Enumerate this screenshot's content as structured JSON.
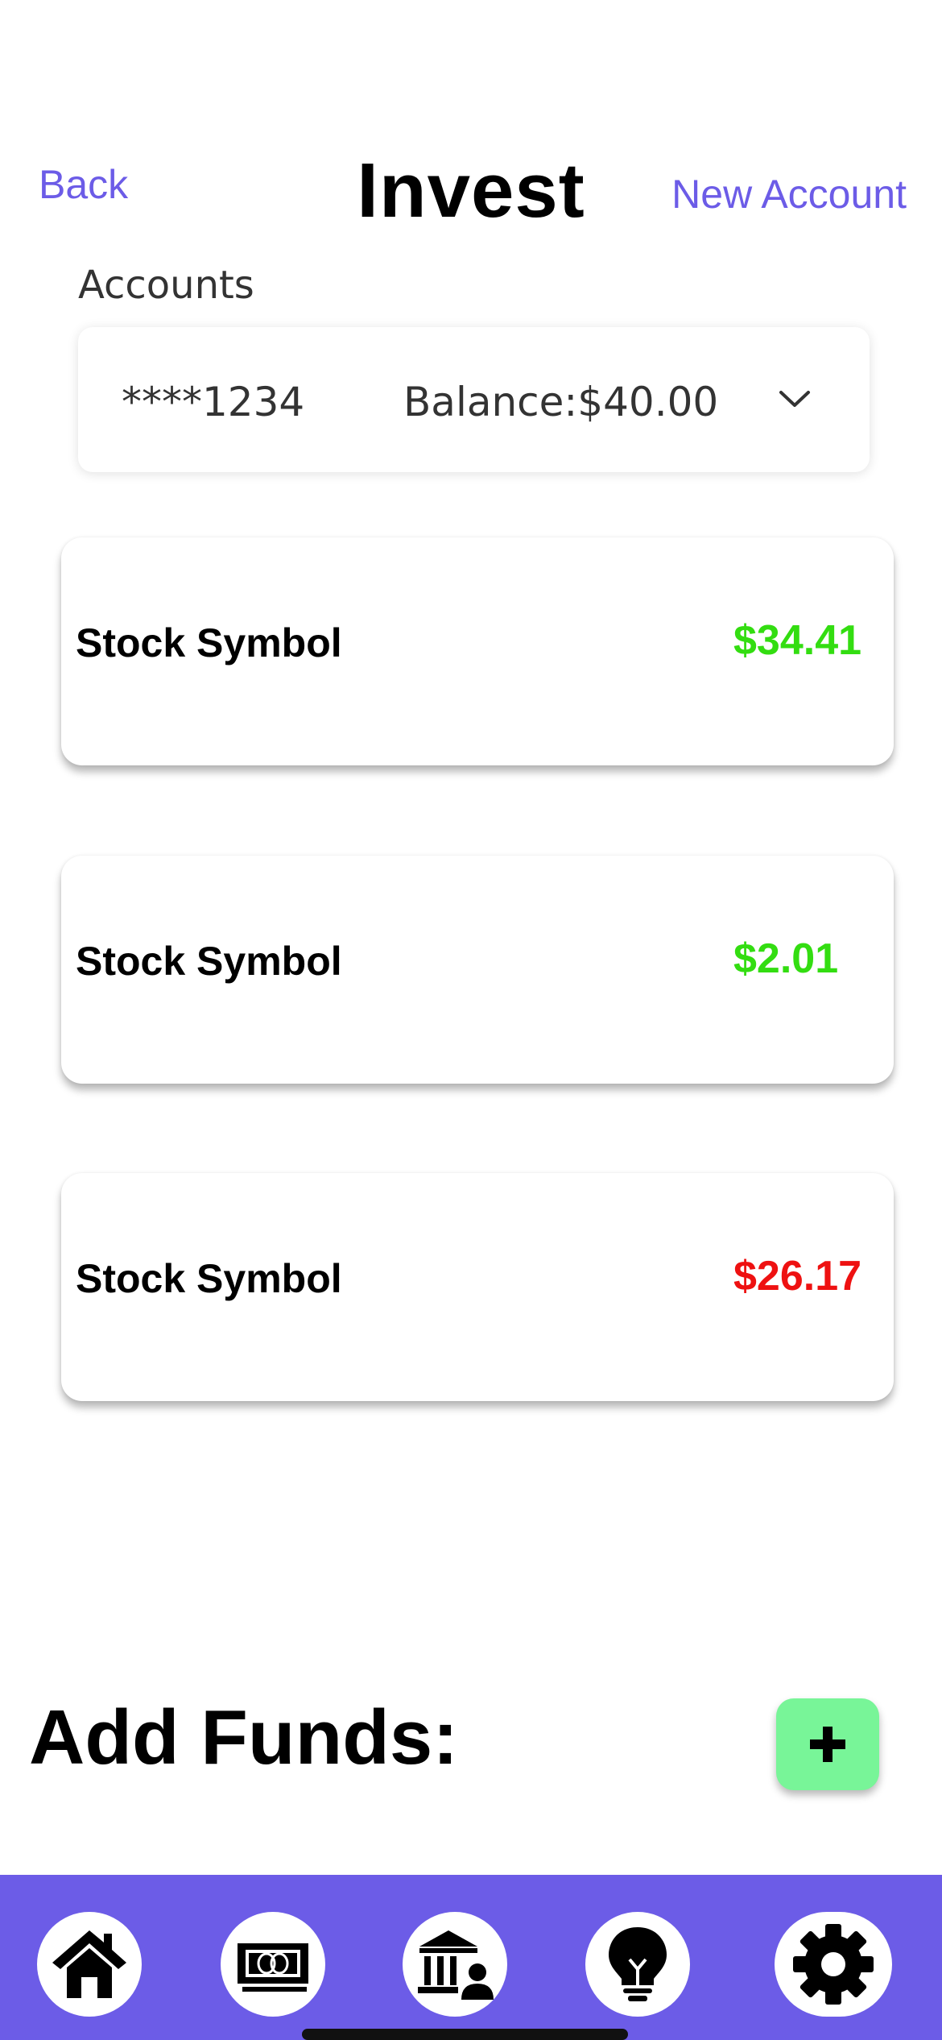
{
  "header": {
    "back_label": "Back",
    "title": "Invest",
    "new_account_label": "New Account"
  },
  "accounts": {
    "label": "Accounts",
    "selected_account": "****1234",
    "balance": "Balance:$40.00",
    "dropdown_icon": "chevron-down-icon"
  },
  "stocks": [
    {
      "symbol": "Stock Symbol",
      "price": "$34.41",
      "trend": "up"
    },
    {
      "symbol": "Stock Symbol",
      "price": "$2.01",
      "trend": "up"
    },
    {
      "symbol": "Stock Symbol",
      "price": "$26.17",
      "trend": "down"
    }
  ],
  "add_funds": {
    "label": "Add Funds:",
    "button_icon": "plus-icon"
  },
  "tab_bar": {
    "items": [
      "home-icon",
      "cash-icon",
      "bank-icon",
      "lightbulb-icon",
      "gear-icon"
    ]
  },
  "colors": {
    "accent": "#6c5ce7",
    "price_up": "#33dd11",
    "price_down": "#ee1111",
    "add_button": "#78f598"
  }
}
